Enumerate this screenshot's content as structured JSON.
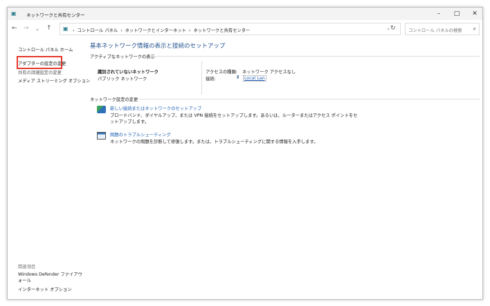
{
  "window": {
    "title": "ネットワークと共有センター",
    "controls": [
      "minimize",
      "maximize",
      "close"
    ]
  },
  "address": {
    "breadcrumbs": [
      "コントロール パネル",
      "ネットワークとインターネット",
      "ネットワークと共有センター"
    ],
    "search_placeholder": "コントロール パネルの検索"
  },
  "sidebar": {
    "items": [
      {
        "label": "コントロール パネル ホーム"
      },
      {
        "label": "アダプターの設定の変更"
      },
      {
        "label": "共有の詳細設定の変更"
      },
      {
        "label": "メディア ストリーミング オプション"
      }
    ],
    "related_heading": "関連項目",
    "related": [
      {
        "label": "Windows Defender ファイアウォール"
      },
      {
        "label": "インターネット オプション"
      }
    ]
  },
  "main": {
    "title": "基本ネットワーク情報の表示と接続のセットアップ",
    "active_heading": "アクティブなネットワークの表示",
    "network": {
      "name": "識別されていないネットワーク",
      "type": "パブリック ネットワーク",
      "access_label": "アクセスの種類:",
      "access_value": "ネットワーク アクセスなし",
      "conn_label": "接続:",
      "conn_value": "Local Lan"
    },
    "change_heading": "ネットワーク設定の変更",
    "tasks": [
      {
        "title": "新しい接続またはネットワークのセットアップ",
        "desc": "ブロードバンド、ダイヤルアップ、または VPN 接続をセットアップします。あるいは、ルーターまたはアクセス ポイントをセ",
        "desc2": "ットアップします。"
      },
      {
        "title": "問題のトラブルシューティング",
        "desc": "ネットワークの問題を診断して修復します。または、トラブルシューティングに関する情報を入手します。"
      }
    ]
  },
  "highlight_color": "#e8352a"
}
